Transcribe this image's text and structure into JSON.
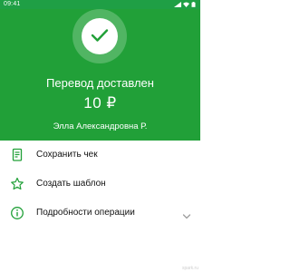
{
  "status_bar": {
    "time": "09:41",
    "icons": [
      "signal-icon",
      "wifi-icon",
      "battery-icon"
    ]
  },
  "transfer": {
    "title": "Перевод доставлен",
    "amount": "10 ₽",
    "recipient": "Элла Александровна Р.",
    "status_icon": "check-icon"
  },
  "actions": [
    {
      "label": "Сохранить чек",
      "icon": "receipt-icon"
    },
    {
      "label": "Создать шаблон",
      "icon": "star-icon"
    },
    {
      "label": "Подробности операции",
      "icon": "info-icon",
      "chevron": "chevron-down-icon"
    }
  ],
  "watermark": "spark.ru",
  "colors": {
    "brand_green": "#21A038",
    "icon_green": "#21A038",
    "text_dark": "#111111",
    "chevron_gray": "#9E9E9E"
  }
}
